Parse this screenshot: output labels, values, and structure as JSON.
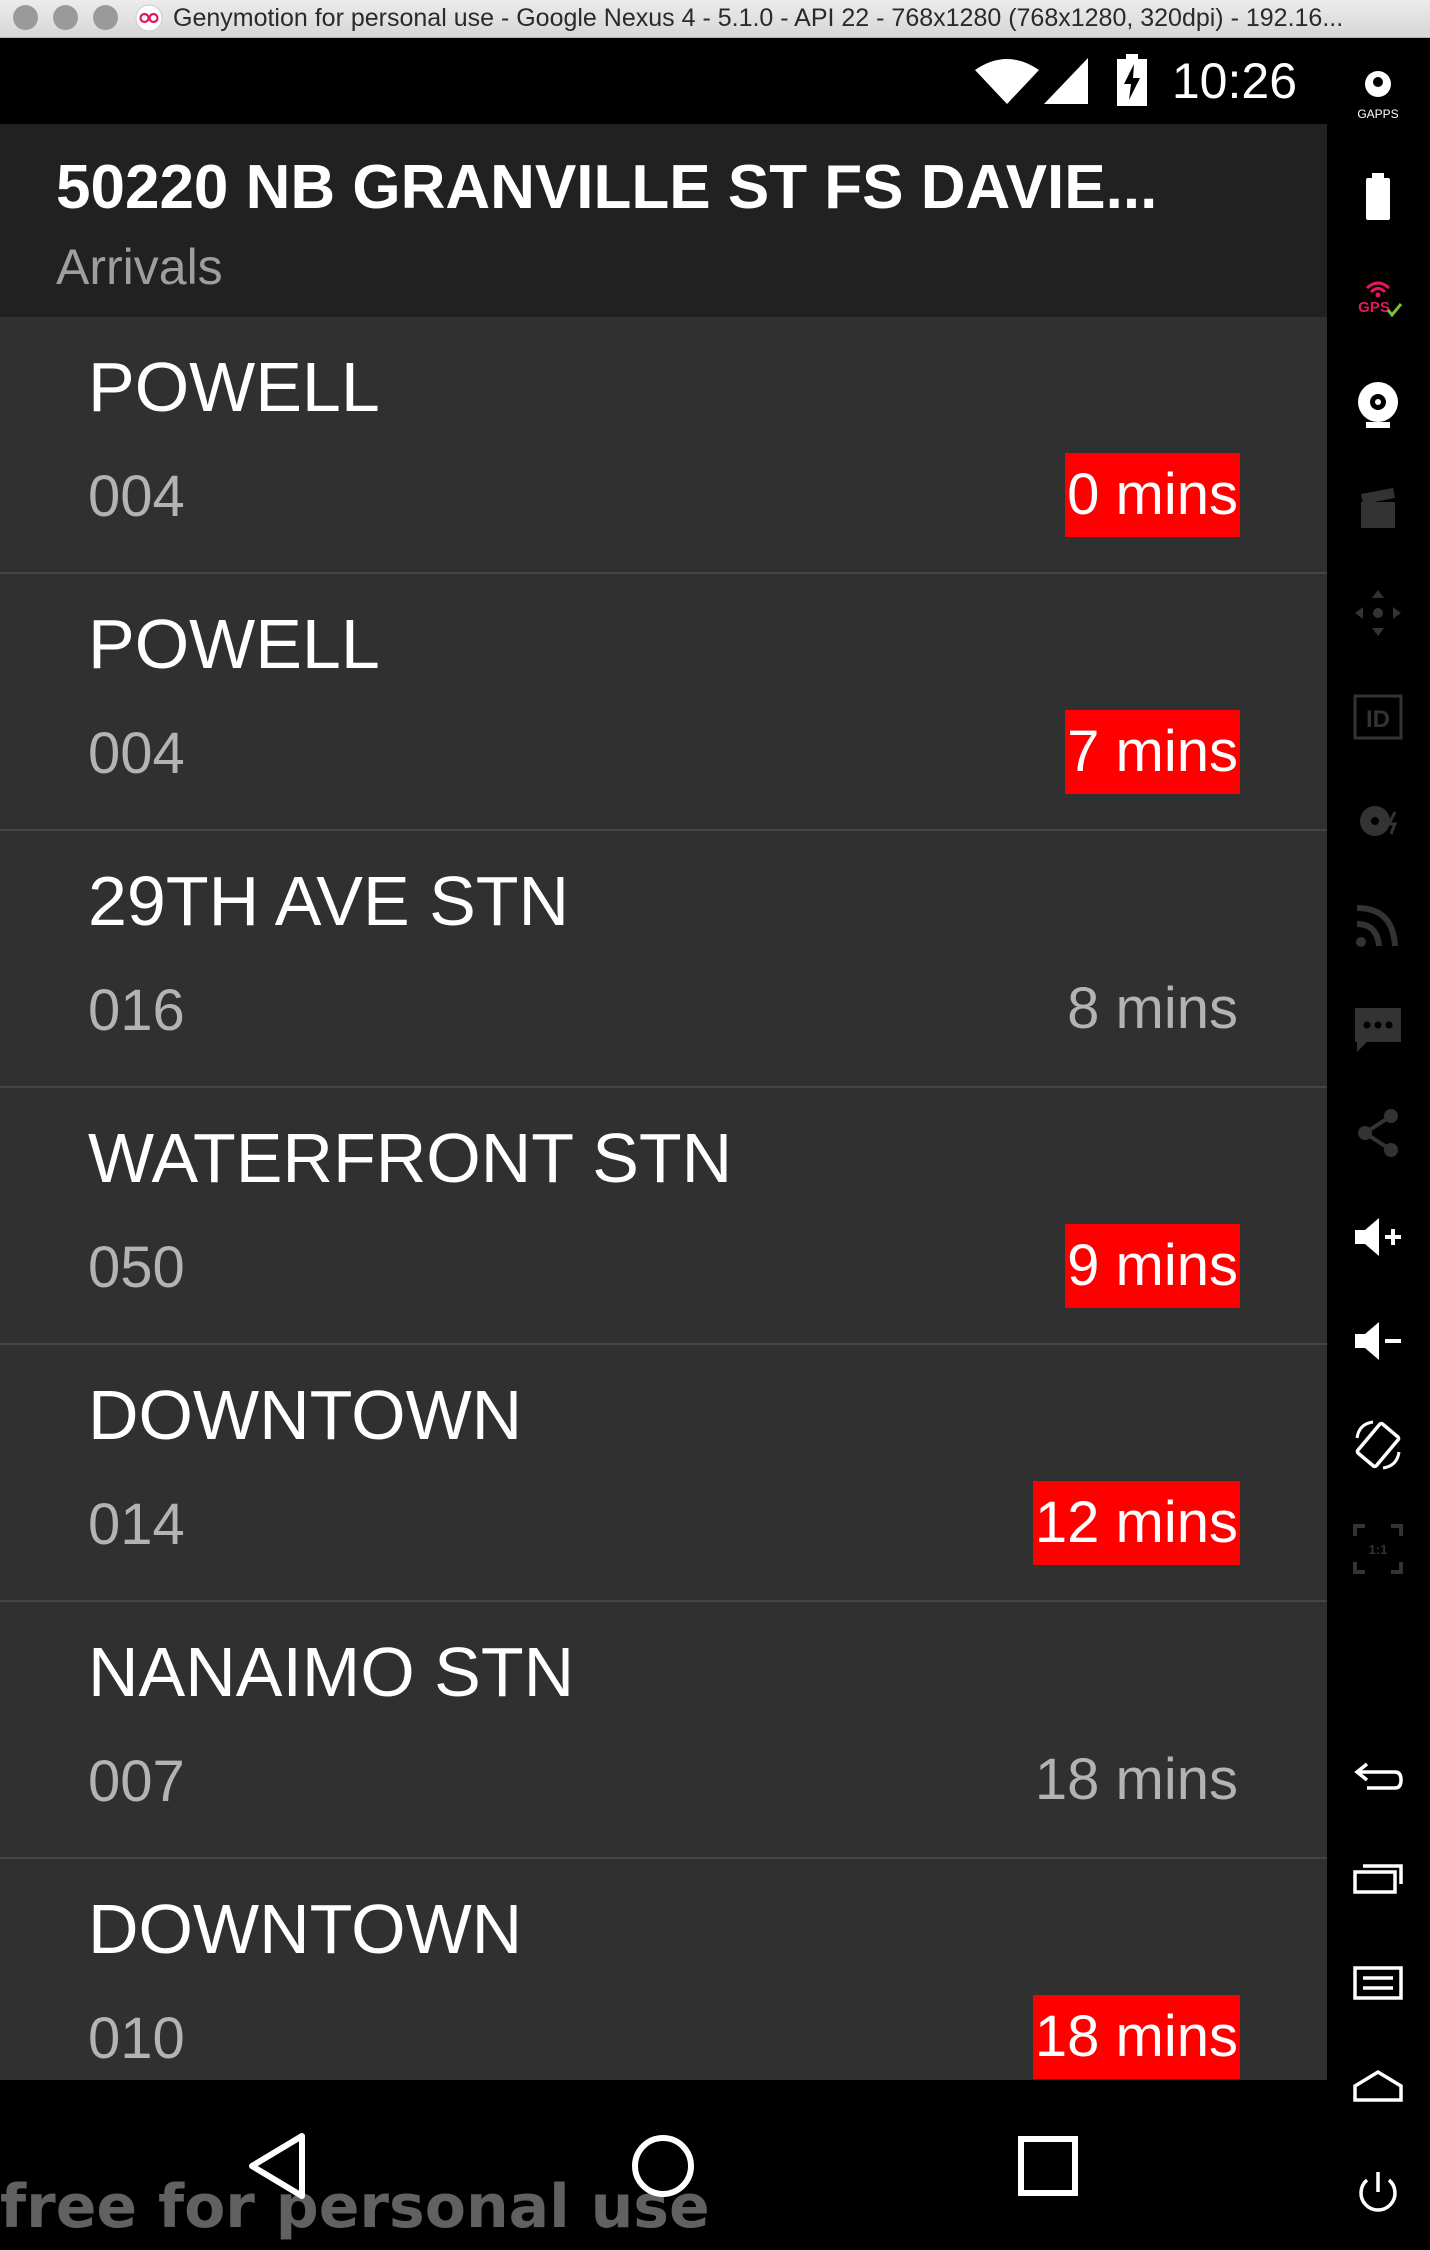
{
  "window": {
    "title": "Genymotion for personal use - Google Nexus 4 - 5.1.0 - API 22 - 768x1280 (768x1280, 320dpi) - 192.16..."
  },
  "status_bar": {
    "time": "10:26",
    "icons": [
      "wifi-icon",
      "signal-icon",
      "battery-charging-icon"
    ]
  },
  "action_bar": {
    "title": "50220 NB GRANVILLE ST FS DAVIE...",
    "subtitle": "Arrivals"
  },
  "arrivals": [
    {
      "destination": "POWELL",
      "route": "004",
      "eta": "0 mins",
      "highlight": true
    },
    {
      "destination": "POWELL",
      "route": "004",
      "eta": "7 mins",
      "highlight": true
    },
    {
      "destination": "29TH AVE STN",
      "route": "016",
      "eta": "8 mins",
      "highlight": false
    },
    {
      "destination": "WATERFRONT STN",
      "route": "050",
      "eta": "9 mins",
      "highlight": true
    },
    {
      "destination": "DOWNTOWN",
      "route": "014",
      "eta": "12 mins",
      "highlight": true
    },
    {
      "destination": "NANAIMO STN",
      "route": "007",
      "eta": "18 mins",
      "highlight": false
    },
    {
      "destination": "DOWNTOWN",
      "route": "010",
      "eta": "18 mins",
      "highlight": true
    }
  ],
  "nav_bar": {
    "buttons": [
      "back-icon",
      "home-icon",
      "recents-icon"
    ]
  },
  "watermark": "free for personal use",
  "sidebar": {
    "gapps_label": "GAPPS",
    "gps_label": "GPS",
    "id_label": "ID",
    "scale_label": "1:1",
    "icons": [
      "gapps-icon",
      "battery-icon",
      "gps-icon",
      "webcam-icon",
      "screencast-icon",
      "dpad-icon",
      "device-id-icon",
      "disk-icon",
      "rss-icon",
      "sms-icon",
      "share-icon",
      "volume-up-icon",
      "volume-down-icon",
      "rotate-icon",
      "scale-icon",
      "back-icon",
      "recents-icon",
      "menu-icon",
      "home-icon",
      "power-icon"
    ]
  },
  "colors": {
    "highlight": "#ff0000",
    "list_bg": "#303030",
    "action_bar_bg": "#212121"
  }
}
